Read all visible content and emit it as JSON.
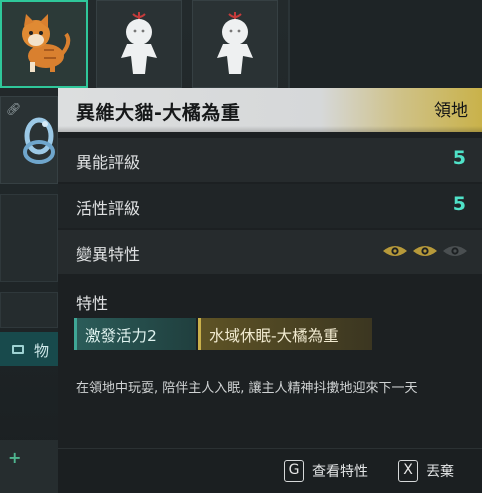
{
  "inventory": {
    "section_label": "物",
    "slots": [
      {
        "item": "orange-tabby-cat",
        "selected": true
      },
      {
        "item": "white-doll",
        "selected": false
      },
      {
        "item": "white-doll",
        "selected": false
      },
      {
        "item": "blue-glass-knot",
        "selected": false
      }
    ]
  },
  "tooltip": {
    "title": "異維大貓-大橘為重",
    "tag": "領地",
    "stats": [
      {
        "label": "異能評級",
        "value": "5"
      },
      {
        "label": "活性評級",
        "value": "5"
      }
    ],
    "mutation": {
      "label": "變異特性",
      "eyes_filled": 2,
      "eyes_total": 3
    },
    "traits_label": "特性",
    "traits": [
      {
        "label": "激發活力2",
        "style": "teal"
      },
      {
        "label": "水域休眠-大橘為重",
        "style": "gold"
      }
    ],
    "description": "在領地中玩耍, 陪伴主人入眠, 讓主人精神抖擻地迎來下一天",
    "footer": {
      "view_key": "G",
      "view_label": "查看特性",
      "discard_key": "X",
      "discard_label": "丟棄"
    }
  },
  "colors": {
    "accent_teal": "#4fe2c8",
    "accent_gold": "#c9b04a",
    "selected_border": "#2fc79a"
  }
}
